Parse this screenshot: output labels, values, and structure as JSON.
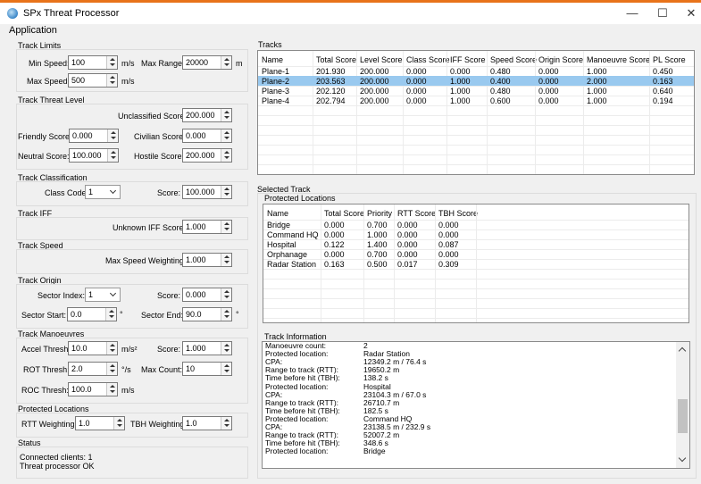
{
  "window": {
    "title": "SPx Threat Processor",
    "minimize_glyph": "—",
    "maximize_glyph": "☐",
    "close_glyph": "✕"
  },
  "menu": {
    "application": "Application"
  },
  "track_limits": {
    "title": "Track Limits",
    "min_speed_label": "Min Speed:",
    "min_speed_value": "100",
    "min_speed_unit": "m/s",
    "max_range_label": "Max Range:",
    "max_range_value": "20000",
    "max_range_unit": "m",
    "max_speed_label": "Max Speed:",
    "max_speed_value": "500",
    "max_speed_unit": "m/s"
  },
  "track_threat_level": {
    "title": "Track Threat Level",
    "unclassified_label": "Unclassified Score:",
    "unclassified_value": "200.000",
    "friendly_label": "Friendly Score:",
    "friendly_value": "0.000",
    "civilian_label": "Civilian Score:",
    "civilian_value": "0.000",
    "neutral_label": "Neutral Score:",
    "neutral_value": "100.000",
    "hostile_label": "Hostile Score:",
    "hostile_value": "200.000"
  },
  "track_classification": {
    "title": "Track Classification",
    "class_code_label": "Class Code:",
    "class_code_value": "1",
    "score_label": "Score:",
    "score_value": "100.000"
  },
  "track_iff": {
    "title": "Track IFF",
    "unknown_label": "Unknown IFF Score:",
    "unknown_value": "1.000"
  },
  "track_speed": {
    "title": "Track Speed",
    "weighting_label": "Max Speed Weighting:",
    "weighting_value": "1.000"
  },
  "track_origin": {
    "title": "Track Origin",
    "sector_index_label": "Sector Index:",
    "sector_index_value": "1",
    "score_label": "Score:",
    "score_value": "0.000",
    "sector_start_label": "Sector Start:",
    "sector_start_value": "0.0",
    "sector_start_unit": "°",
    "sector_end_label": "Sector End:",
    "sector_end_value": "90.0",
    "sector_end_unit": "°"
  },
  "track_manoeuvres": {
    "title": "Track Manoeuvres",
    "accel_label": "Accel Thresh:",
    "accel_value": "10.0",
    "accel_unit": "m/s²",
    "score_label": "Score:",
    "score_value": "1.000",
    "rot_label": "ROT Thresh:",
    "rot_value": "2.0",
    "rot_unit": "°/s",
    "max_count_label": "Max Count:",
    "max_count_value": "10",
    "roc_label": "ROC Thresh:",
    "roc_value": "100.0",
    "roc_unit": "m/s"
  },
  "protected_locations_settings": {
    "title": "Protected Locations",
    "rtt_label": "RTT Weighting:",
    "rtt_value": "1.0",
    "tbh_label": "TBH Weighting:",
    "tbh_value": "1.0"
  },
  "status": {
    "title": "Status",
    "line1": "Connected clients: 1",
    "line2": "Threat processor OK"
  },
  "tracks": {
    "title": "Tracks",
    "columns": [
      "Name",
      "Total Score",
      "Level Score",
      "Class Score",
      "IFF Score",
      "Speed Score",
      "Origin Score",
      "Manoeuvre Score",
      "PL Score"
    ],
    "rows": [
      [
        "Plane-1",
        "201.930",
        "200.000",
        "0.000",
        "0.000",
        "0.480",
        "0.000",
        "1.000",
        "0.450"
      ],
      [
        "Plane-2",
        "203.563",
        "200.000",
        "0.000",
        "1.000",
        "0.400",
        "0.000",
        "2.000",
        "0.163"
      ],
      [
        "Plane-3",
        "202.120",
        "200.000",
        "0.000",
        "1.000",
        "0.480",
        "0.000",
        "1.000",
        "0.640"
      ],
      [
        "Plane-4",
        "202.794",
        "200.000",
        "0.000",
        "1.000",
        "0.600",
        "0.000",
        "1.000",
        "0.194"
      ]
    ],
    "selected_index": 1
  },
  "selected_track": {
    "title": "Selected Track",
    "protected_locations_title": "Protected Locations",
    "columns": [
      "Name",
      "Total Score",
      "Priority",
      "RTT Score",
      "TBH Score"
    ],
    "rows": [
      [
        "Bridge",
        "0.000",
        "0.700",
        "0.000",
        "0.000"
      ],
      [
        "Command HQ",
        "0.000",
        "1.000",
        "0.000",
        "0.000"
      ],
      [
        "Hospital",
        "0.122",
        "1.400",
        "0.000",
        "0.087"
      ],
      [
        "Orphanage",
        "0.000",
        "0.700",
        "0.000",
        "0.000"
      ],
      [
        "Radar Station",
        "0.163",
        "0.500",
        "0.017",
        "0.309"
      ]
    ],
    "track_information_title": "Track Information",
    "info_lines": [
      [
        "Manoeuvre count:",
        "2"
      ],
      [
        "Protected location:",
        "Radar Station"
      ],
      [
        "   CPA:",
        "12349.2 m / 76.4 s"
      ],
      [
        "   Range to track (RTT):",
        "19650.2 m"
      ],
      [
        "   Time before hit (TBH):",
        "138.2 s"
      ],
      [
        "Protected location:",
        "Hospital"
      ],
      [
        "   CPA:",
        "23104.3 m / 67.0 s"
      ],
      [
        "   Range to track (RTT):",
        "26710.7 m"
      ],
      [
        "   Time before hit (TBH):",
        "182.5 s"
      ],
      [
        "Protected location:",
        "Command HQ"
      ],
      [
        "   CPA:",
        "23138.5 m / 232.9 s"
      ],
      [
        "   Range to track (RTT):",
        "52007.2 m"
      ],
      [
        "   Time before hit (TBH):",
        "348.6 s"
      ],
      [
        "Protected location:",
        "Bridge"
      ]
    ]
  },
  "colors": {
    "accent_bar": "#e8731a",
    "selection": "#99c9ef"
  }
}
